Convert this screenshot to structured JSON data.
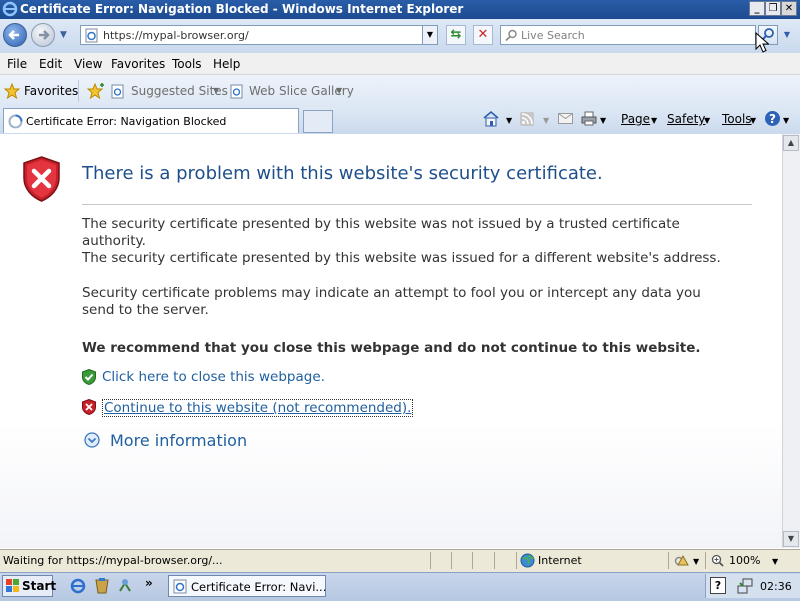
{
  "window": {
    "title": "Certificate Error: Navigation Blocked - Windows Internet Explorer"
  },
  "address_bar": {
    "url": "https://mypal-browser.org/"
  },
  "search": {
    "placeholder": "Live Search"
  },
  "menu": {
    "items": [
      "File",
      "Edit",
      "View",
      "Favorites",
      "Tools",
      "Help"
    ]
  },
  "favorites_bar": {
    "favorites_label": "Favorites",
    "suggested_sites": "Suggested Sites",
    "web_slice_gallery": "Web Slice Gallery"
  },
  "tab": {
    "title": "Certificate Error: Navigation Blocked"
  },
  "command_bar": {
    "page": "Page",
    "safety": "Safety",
    "tools": "Tools"
  },
  "page": {
    "heading": "There is a problem with this website's security certificate.",
    "para1_line1": "The security certificate presented by this website was not issued by a trusted certificate",
    "para1_line2": "authority.",
    "para1_line3": "The security certificate presented by this website was issued for a different website's address.",
    "para2_line1": "Security certificate problems may indicate an attempt to fool you or intercept any data you",
    "para2_line2": "send to the server.",
    "recommendation": "We recommend that you close this webpage and do not continue to this website.",
    "close_link": "Click here to close this webpage.",
    "continue_link": "Continue to this website (not recommended).",
    "more_info": "More information"
  },
  "status_bar": {
    "status": "Waiting for https://mypal-browser.org/...",
    "zone": "Internet",
    "zoom": "100%"
  },
  "taskbar": {
    "start": "Start",
    "task": "Certificate Error: Navi...",
    "clock": "02:36"
  },
  "colors": {
    "heading": "#1f4f8a",
    "link": "#1f5fa0",
    "shield_red": "#c8202a",
    "shield_green": "#3a9a3a"
  }
}
